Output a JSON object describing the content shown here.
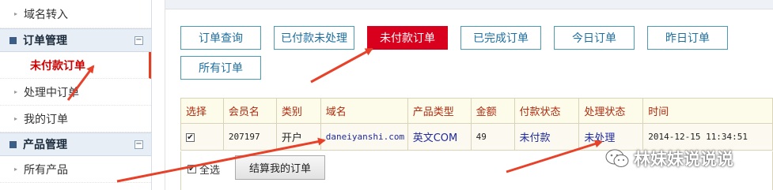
{
  "sidebar": {
    "items": [
      {
        "type": "item",
        "label": "域名转入"
      },
      {
        "type": "group",
        "label": "订单管理",
        "toggle": "−"
      },
      {
        "type": "active",
        "label": "未付款订单"
      },
      {
        "type": "item",
        "label": "处理中订单"
      },
      {
        "type": "item",
        "label": "我的订单"
      },
      {
        "type": "group",
        "label": "产品管理",
        "toggle": "−"
      },
      {
        "type": "item",
        "label": "所有产品"
      }
    ]
  },
  "filter_buttons": [
    {
      "label": "订单查询",
      "active": false
    },
    {
      "label": "已付款未处理",
      "active": false
    },
    {
      "label": "未付款订单",
      "active": true
    },
    {
      "label": "已完成订单",
      "active": false
    },
    {
      "label": "今日订单",
      "active": false
    },
    {
      "label": "昨日订单",
      "active": false
    },
    {
      "label": "所有订单",
      "active": false
    }
  ],
  "table": {
    "headers": [
      "选择",
      "会员名",
      "类别",
      "域名",
      "产品类型",
      "金额",
      "付款状态",
      "处理状态",
      "时间"
    ],
    "rows": [
      {
        "checked": true,
        "member": "207197",
        "category": "开户",
        "domain": "daneiyanshi.com",
        "product": "英文COM",
        "amount": "49",
        "payment_status": "未付款",
        "process_status": "未处理",
        "time": "2014-12-15 11:34:51"
      }
    ]
  },
  "footer": {
    "select_all_label": "全选",
    "settle_button": "结算我的订单"
  },
  "watermark": "林妹妹说说说",
  "colors": {
    "accent_red": "#d8001c",
    "button_border": "#4a9bb5",
    "annotation_arrow": "#e8412a"
  }
}
